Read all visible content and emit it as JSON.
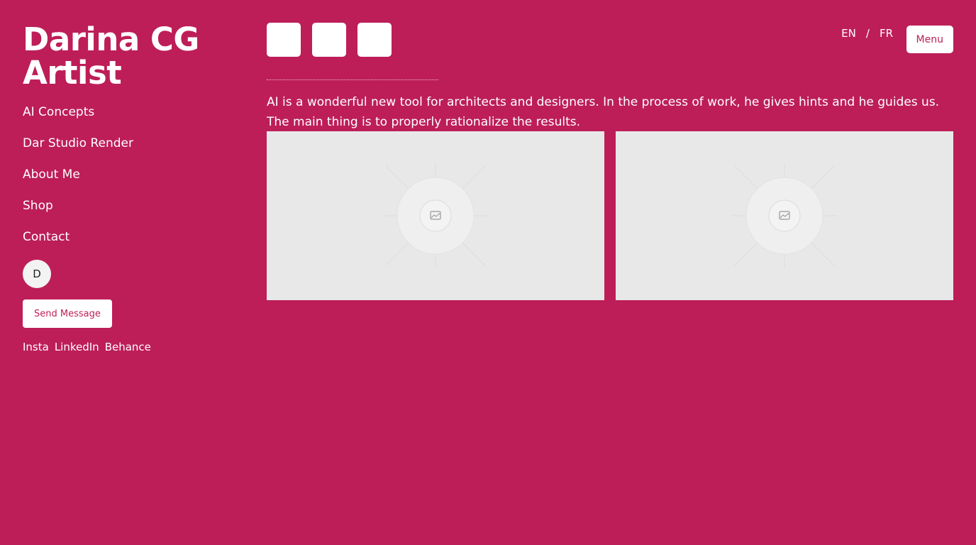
{
  "site": {
    "title_line1": "Darina CG",
    "title_line2": "Artist"
  },
  "nav": {
    "items": [
      {
        "label": "AI Concepts"
      },
      {
        "label": "Dar Studio Render"
      },
      {
        "label": "About Me"
      },
      {
        "label": "Shop"
      },
      {
        "label": "Contact"
      }
    ]
  },
  "profile": {
    "avatar_initial": "D",
    "send_message_label": "Send Message"
  },
  "socials": {
    "links": [
      {
        "label": "Insta"
      },
      {
        "label": "LinkedIn"
      },
      {
        "label": "Behance"
      }
    ]
  },
  "header": {
    "lang_en": "EN",
    "lang_separator": "/",
    "lang_fr": "FR",
    "menu_label": "Menu"
  },
  "main": {
    "intro_text": "AI is a wonderful new tool for architects and designers. In the process of work, he gives hints and he guides us. The main thing is to properly rationalize the results."
  },
  "colors": {
    "background": "#bd1e58",
    "button_bg": "#ffffff",
    "button_text": "#bd1e58",
    "placeholder_bg": "#e8e8e8"
  },
  "icons": {
    "image_placeholder": "image-placeholder-icon"
  }
}
